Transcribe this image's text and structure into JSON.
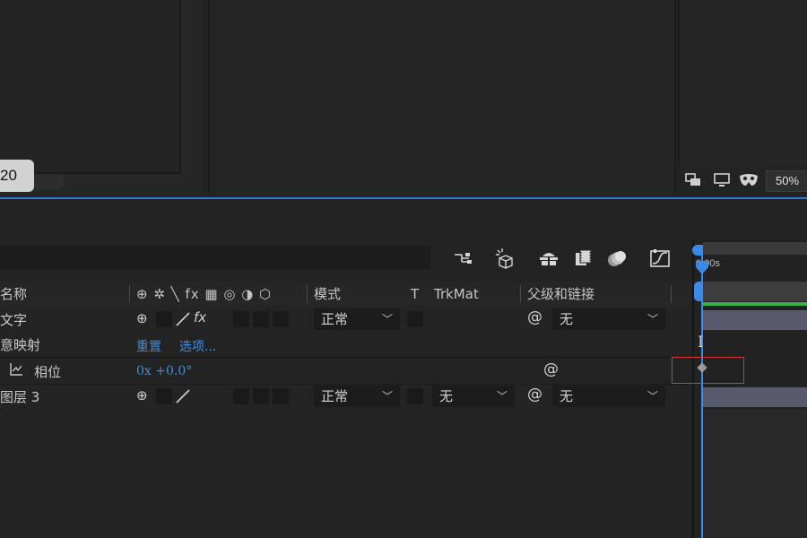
{
  "viewer": {
    "frame_value": "20",
    "zoom": "50%",
    "icons": [
      "snapshot-icon",
      "monitor-icon",
      "mask-icon"
    ]
  },
  "toolbar": {
    "icons": [
      "flowchart-icon",
      "draft-3d-icon",
      "shy-layers-icon",
      "frame-blending-icon",
      "motion-blur-icon",
      "graph-editor-icon"
    ]
  },
  "columns": {
    "name": "名称",
    "switch_glyphs": "⊕ ✲ ╲ fx ▦ ◎ ◑ ⬡",
    "mode": "模式",
    "t": "T",
    "trkmat": "TrkMat",
    "parent": "父级和链接"
  },
  "rows": [
    {
      "name": "文字",
      "mode": "正常",
      "parent": "无"
    },
    {
      "name": "意映射",
      "reset": "重置",
      "options": "选项..."
    },
    {
      "name": "相位",
      "value": "0x +0.0°"
    },
    {
      "name": "图层 3",
      "mode": "正常",
      "trkmat": "无",
      "parent": "无"
    }
  ],
  "timeline": {
    "time_label": "0:00s"
  },
  "colors": {
    "accent_blue": "#2d7ad8",
    "link_blue": "#3d8fe0",
    "green_bar": "#37b24a",
    "highlight_red": "#d23a3a"
  }
}
